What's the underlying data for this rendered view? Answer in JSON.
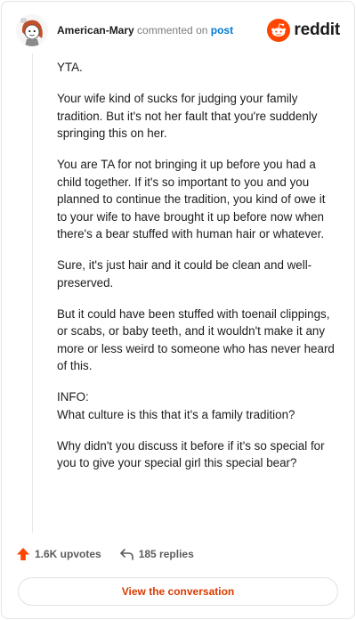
{
  "header": {
    "username": "American-Mary",
    "action_text": " commented on ",
    "post_link": "post",
    "brand_name": "reddit",
    "avatar_icon": "snoo-avatar-icon",
    "brand_icon": "reddit-logo-icon"
  },
  "comment": {
    "paragraphs": [
      "YTA.",
      "Your wife kind of sucks for judging your family tradition. But it's not her fault that you're suddenly springing this on her.",
      "You are TA for not bringing it up before you had a child together. If it's so important to you and you planned to continue the tradition, you kind of owe it to your wife to have brought it up before now when there's a bear stuffed with human hair or whatever.",
      "Sure, it's just hair and it could be clean and well-preserved.",
      "But it could have been stuffed with toenail clippings, or scabs, or baby teeth, and it wouldn't make it any more or less weird to someone who has never heard of this.",
      "INFO:",
      "What culture is this that it's a family tradition?",
      "Why didn't you discuss it before if it's so special for you to give your special girl this special bear?"
    ]
  },
  "footer": {
    "upvotes": "1.6K upvotes",
    "replies": "185 replies",
    "cta_label": "View the conversation",
    "upvote_icon": "upvote-arrow-icon",
    "reply_icon": "reply-arrow-icon"
  },
  "colors": {
    "brand": "#ff4500",
    "link": "#0079d3",
    "cta": "#d93a00"
  }
}
